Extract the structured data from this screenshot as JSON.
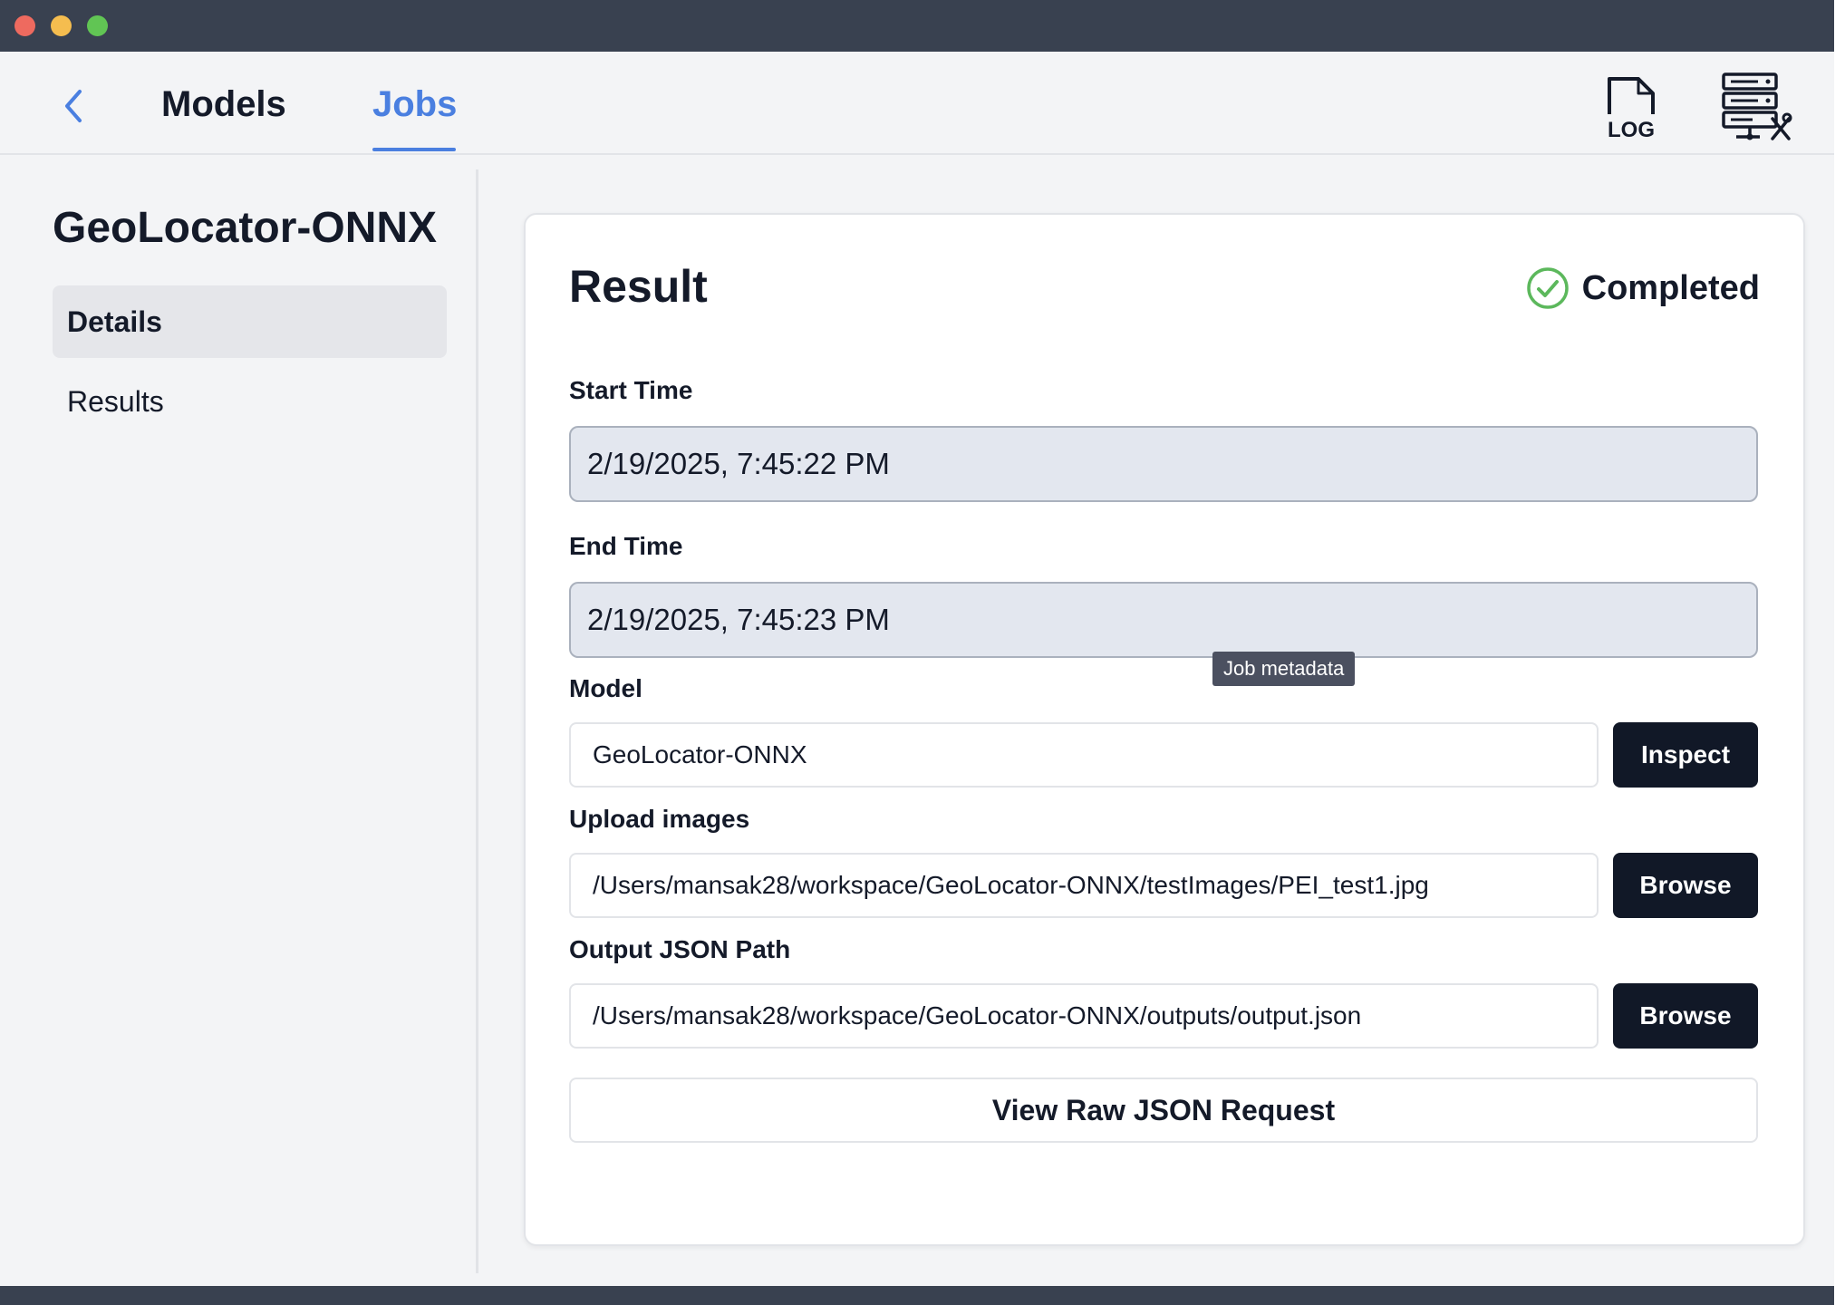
{
  "nav": {
    "tabs": [
      {
        "label": "Models"
      },
      {
        "label": "Jobs"
      }
    ],
    "log_icon_text": "LOG",
    "active_tab": "Jobs"
  },
  "sidebar": {
    "title": "GeoLocator-ONNX",
    "items": [
      {
        "label": "Details"
      },
      {
        "label": "Results"
      }
    ]
  },
  "card": {
    "title": "Result",
    "status": "Completed",
    "start_time_label": "Start Time",
    "start_time_value": "2/19/2025, 7:45:22 PM",
    "end_time_label": "End Time",
    "end_time_value": "2/19/2025, 7:45:23 PM",
    "tooltip": "Job metadata",
    "model_label": "Model",
    "model_value": "GeoLocator-ONNX",
    "inspect_label": "Inspect",
    "upload_label": "Upload images",
    "upload_value": "/Users/mansak28/workspace/GeoLocator-ONNX/testImages/PEI_test1.jpg",
    "browse_label": "Browse",
    "output_label": "Output JSON Path",
    "output_value": "/Users/mansak28/workspace/GeoLocator-ONNX/outputs/output.json",
    "raw_json_label": "View Raw JSON Request"
  },
  "colors": {
    "accent": "#4a7fe0",
    "status_green": "#5cb85c",
    "dark_button": "#111827",
    "titlebar": "#394150"
  },
  "icons": [
    "back-chevron-icon",
    "log-file-icon",
    "server-settings-icon",
    "check-circle-icon"
  ]
}
